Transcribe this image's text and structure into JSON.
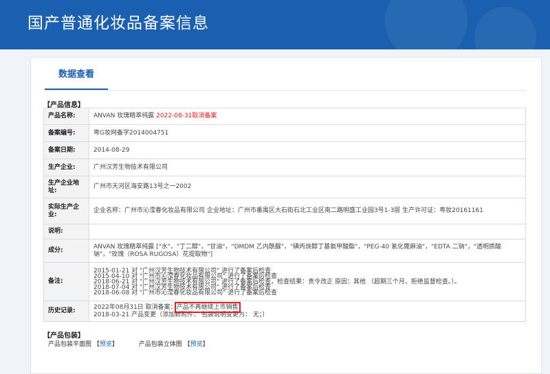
{
  "header": {
    "title": "国产普通化妆品备案信息"
  },
  "tab": {
    "label": "数据查看"
  },
  "product_section": {
    "title": "【产品信息】"
  },
  "rows": {
    "name_label": "产品名称:",
    "name_value": "ANVAN 玫瑰精萃纯露",
    "name_status": "2022-08-31取消备案",
    "reg_no_label": "备案编号:",
    "reg_no_value": "粤G妆网备字2014004751",
    "date_label": "备案日期:",
    "date_value": "2014-08-29",
    "maker_label": "生产企业:",
    "maker_value": "广州汉芳生物技术有限公司",
    "addr_label": "生产企业地址:",
    "addr_value": "广州市天河区海安路13号之一2002",
    "actual_label": "实际生产企业:",
    "actual_value": "企业名称：广州市沁滢春化妆品有限公司 企业地址：广州市番禺区大石街石北工业区南二路明盛工业园3号1-3层 生产许可证：粤妆20161161",
    "desc_label": "说明:",
    "desc_value": "",
    "ingr_label": "成分:",
    "ingr_value": "ANVAN 玫瑰精萃纯露 [\"水\"，\"丁二醇\"，\"甘油\"，\"DMDM 乙内酰脲\"，\"碘丙炔醇丁基氨甲酸酯\"，\"PEG-40 氢化蓖麻油\"，\"EDTA 二钠\"，\"透明质酸钠\"，\"玫瑰（ROSA RUGOSA）花提取物\"]",
    "remark_label": "备注:",
    "remark_lines": [
      "2015-01-21 对 \"广州汉芳生物技术有限公司\" 进行了备案后检查",
      "2015-04-10 对 \"广州市沁滢春化妆品有限公司\" 进行了备案后检查",
      "2018-06-21 对 \"广州汉芳生物技术有限公司\" 进行了备案后检查，检查结果：责令改正 原因：其他 （超期三个月，拒绝监督检查。）。",
      "2018-07-04 对 \"广州汉芳生物技术有限公司\" 进行了备案后检查",
      "2018-06-08 对 \"广州市沁滢春化妆品有限公司\" 进行了备案后检查"
    ],
    "history_label": "历史记录:",
    "history_line1_a": "2022年08月31日 取消备案：",
    "history_line1_b": "产品不再继续上市销售",
    "history_line2": "2018-03-21 产品变更（添加新附件： 包装说明变更为： 无；）"
  },
  "package_section": {
    "title": "【产品包装】",
    "flat_label": "产品包装平面图",
    "flat_link": "预览",
    "solid_label": "产品包装立体图",
    "solid_link": "预览",
    "bracket_open": "【",
    "bracket_close": "】"
  },
  "colors": {
    "header_bg": "#1b60b0",
    "accent": "#1b60b0",
    "status_red": "#e02020"
  }
}
